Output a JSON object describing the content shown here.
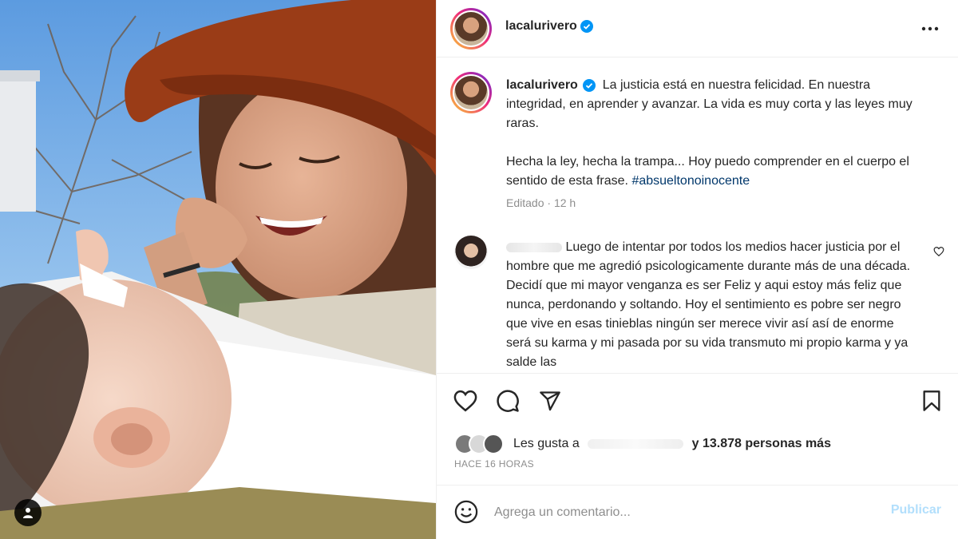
{
  "post": {
    "author": {
      "username": "lacalurivero",
      "verified": true,
      "avatar": "profile-avatar"
    },
    "caption": {
      "paragraph1": "La justicia está en nuestra felicidad. En nuestra integridad, en aprender y avanzar. La vida es muy corta y las leyes muy raras.",
      "paragraph2": "Hecha la ley, hecha la trampa... Hoy puedo comprender en el cuerpo el sentido de esta frase.",
      "hashtag": "#absueltonoinocente"
    },
    "meta": {
      "edited": "Editado",
      "separator": "·",
      "time_ago": "12 h"
    },
    "comment": {
      "text": "Luego de intentar por todos los medios hacer justicia por el hombre que me agredió psicologicamente durante más de una década. Decidí que mi mayor venganza es ser Feliz y aqui estoy más feliz que nunca, perdonando y soltando. Hoy el sentimiento es pobre ser negro que vive en esas tinieblas ningún ser merece vivir así así de enorme será su karma y mi pasada por su vida transmuto mi propio karma y ya salde las"
    },
    "likes": {
      "prefix": "Les gusta a",
      "suffix": "y 13.878 personas más"
    },
    "timestamp": "HACE 16 HORAS",
    "add_comment": {
      "placeholder": "Agrega un comentario...",
      "publish_label": "Publicar"
    }
  },
  "icons": [
    "more-options-icon",
    "verified-icon",
    "heart-icon",
    "comment-icon",
    "share-icon",
    "save-icon",
    "emoji-icon",
    "user-tag-icon"
  ],
  "colors": {
    "link": "#00376b",
    "verified": "#0095f6",
    "publish_disabled": "#b2dffc",
    "muted": "#8e8e8e"
  }
}
